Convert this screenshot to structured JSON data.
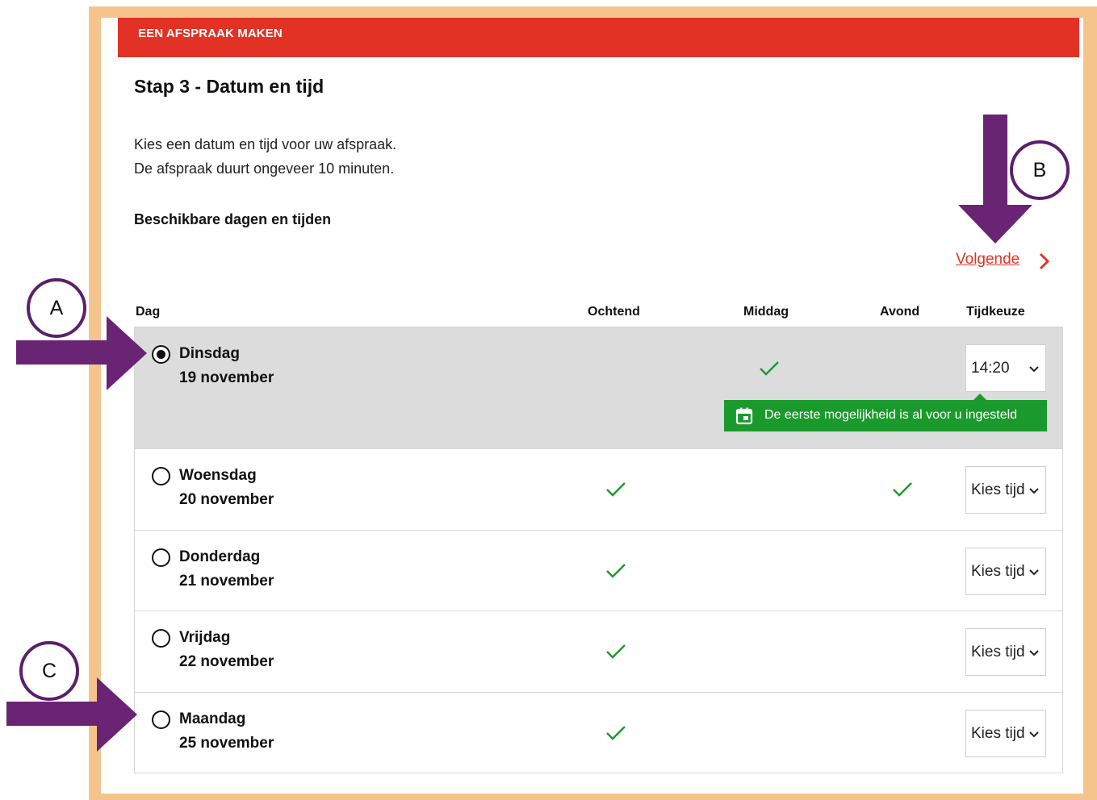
{
  "header": {
    "banner": "EEN AFSPRAAK MAKEN"
  },
  "step_title": "Stap 3 - Datum en tijd",
  "intro": {
    "line1": "Kies een datum en tijd voor uw afspraak.",
    "line2": "De afspraak duurt ongeveer 10 minuten."
  },
  "section_title": "Beschikbare dagen en tijden",
  "next_link": "Volgende",
  "columns": {
    "day": "Dag",
    "morning": "Ochtend",
    "afternoon": "Middag",
    "evening": "Avond",
    "time_choice": "Tijdkeuze"
  },
  "rows": [
    {
      "day": "Dinsdag",
      "date": "19 november",
      "selected": true,
      "morning": false,
      "afternoon": true,
      "evening": false,
      "time": "14:20"
    },
    {
      "day": "Woensdag",
      "date": "20 november",
      "selected": false,
      "morning": true,
      "afternoon": false,
      "evening": true,
      "time": "Kies tijd"
    },
    {
      "day": "Donderdag",
      "date": "21 november",
      "selected": false,
      "morning": true,
      "afternoon": false,
      "evening": false,
      "time": "Kies tijd"
    },
    {
      "day": "Vrijdag",
      "date": "22 november",
      "selected": false,
      "morning": true,
      "afternoon": false,
      "evening": false,
      "time": "Kies tijd"
    },
    {
      "day": "Maandag",
      "date": "25 november",
      "selected": false,
      "morning": true,
      "afternoon": false,
      "evening": false,
      "time": "Kies tijd"
    }
  ],
  "tooltip": {
    "text": "De eerste mogelijkheid is al voor u ingesteld",
    "icon": "calendar-icon"
  },
  "annotations": {
    "a": "A",
    "b": "B",
    "c": "C"
  },
  "colors": {
    "brand_red": "#e23226",
    "success_green": "#1a9a2c",
    "annotation_purple": "#6a2474",
    "frame": "#f5c48d",
    "selected_row": "#dcdcdc"
  }
}
